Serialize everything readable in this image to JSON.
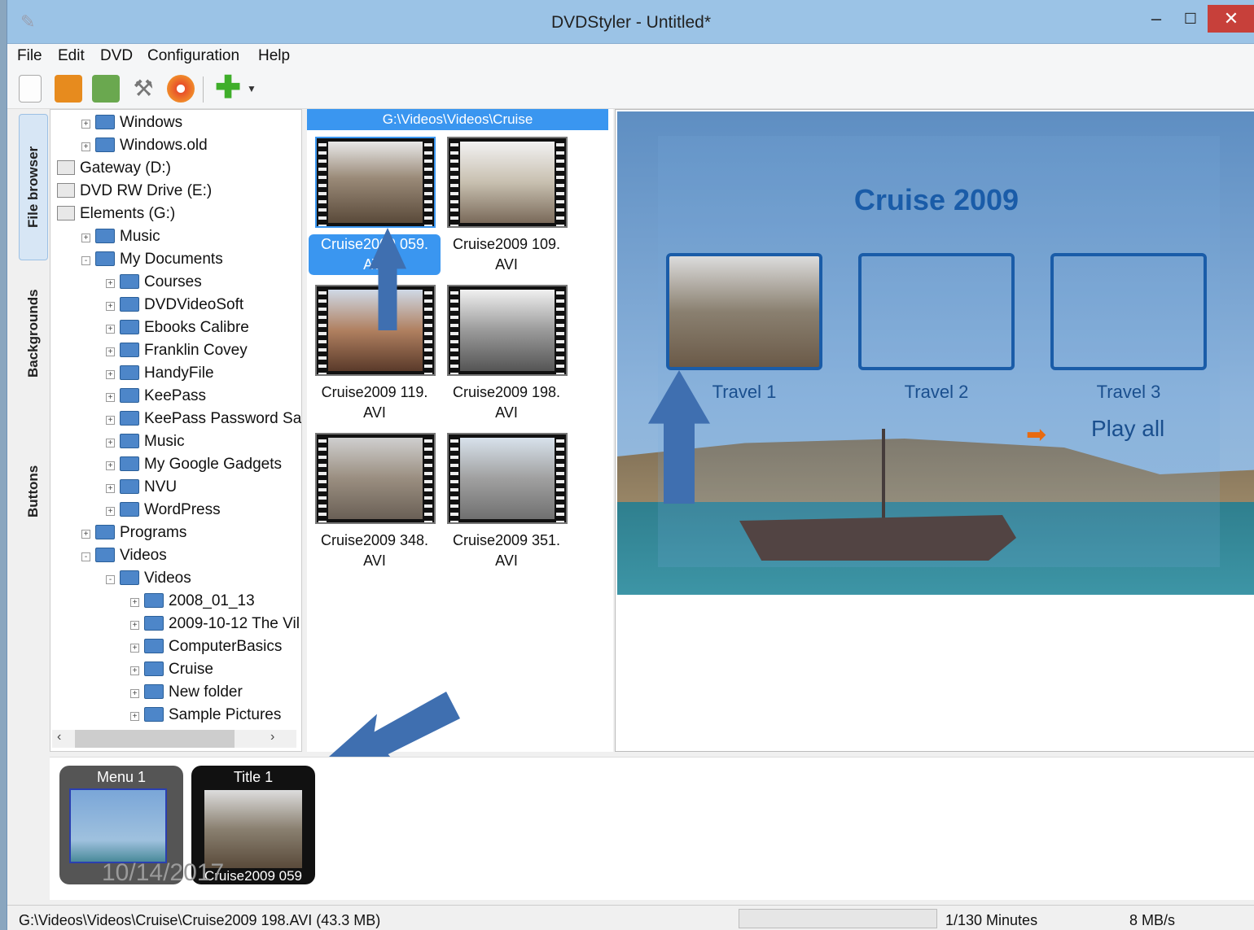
{
  "window": {
    "title": "DVDStyler - Untitled*"
  },
  "menubar": [
    "File",
    "Edit",
    "DVD",
    "Configuration",
    "Help"
  ],
  "side_tabs": [
    "File browser",
    "Backgrounds",
    "Buttons"
  ],
  "file_tree": [
    {
      "label": "Windows",
      "kind": "folder",
      "level": 1,
      "expand": "+"
    },
    {
      "label": "Windows.old",
      "kind": "folder",
      "level": 1,
      "expand": "+"
    },
    {
      "label": "Gateway (D:)",
      "kind": "drive",
      "level": 0,
      "expand": ""
    },
    {
      "label": "DVD RW Drive (E:)",
      "kind": "drive",
      "level": 0,
      "expand": ""
    },
    {
      "label": "Elements (G:)",
      "kind": "drive",
      "level": 0,
      "expand": ""
    },
    {
      "label": "Music",
      "kind": "folder",
      "level": 1,
      "expand": "+"
    },
    {
      "label": "My Documents",
      "kind": "folder",
      "level": 1,
      "expand": "-"
    },
    {
      "label": "Courses",
      "kind": "folder",
      "level": 2,
      "expand": "+"
    },
    {
      "label": "DVDVideoSoft",
      "kind": "folder",
      "level": 2,
      "expand": "+"
    },
    {
      "label": "Ebooks Calibre",
      "kind": "folder",
      "level": 2,
      "expand": "+"
    },
    {
      "label": "Franklin Covey",
      "kind": "folder",
      "level": 2,
      "expand": "+"
    },
    {
      "label": "HandyFile",
      "kind": "folder",
      "level": 2,
      "expand": "+"
    },
    {
      "label": "KeePass",
      "kind": "folder",
      "level": 2,
      "expand": "+"
    },
    {
      "label": "KeePass Password Safe",
      "kind": "folder",
      "level": 2,
      "expand": "+"
    },
    {
      "label": "Music",
      "kind": "folder",
      "level": 2,
      "expand": "+"
    },
    {
      "label": "My Google Gadgets",
      "kind": "folder",
      "level": 2,
      "expand": "+"
    },
    {
      "label": "NVU",
      "kind": "folder",
      "level": 2,
      "expand": "+"
    },
    {
      "label": "WordPress",
      "kind": "folder",
      "level": 2,
      "expand": "+"
    },
    {
      "label": "Programs",
      "kind": "folder",
      "level": 1,
      "expand": "+"
    },
    {
      "label": "Videos",
      "kind": "folder",
      "level": 1,
      "expand": "-"
    },
    {
      "label": "Videos",
      "kind": "folder",
      "level": 2,
      "expand": "-"
    },
    {
      "label": "2008_01_13",
      "kind": "folder",
      "level": 3,
      "expand": "+"
    },
    {
      "label": "2009-10-12 The Vil",
      "kind": "folder",
      "level": 3,
      "expand": "+"
    },
    {
      "label": "ComputerBasics",
      "kind": "folder",
      "level": 3,
      "expand": "+"
    },
    {
      "label": "Cruise",
      "kind": "folder",
      "level": 3,
      "expand": "+"
    },
    {
      "label": "New folder",
      "kind": "folder",
      "level": 3,
      "expand": "+"
    },
    {
      "label": "Sample Pictures",
      "kind": "folder",
      "level": 3,
      "expand": "+"
    }
  ],
  "thumbnails": {
    "path": "G:\\Videos\\Videos\\Cruise",
    "items": [
      {
        "line1": "Cruise2009 059.",
        "line2": "AVI",
        "selected": true
      },
      {
        "line1": "Cruise2009 109.",
        "line2": "AVI",
        "selected": false
      },
      {
        "line1": "Cruise2009 119.",
        "line2": "AVI",
        "selected": false
      },
      {
        "line1": "Cruise2009 198.",
        "line2": "AVI",
        "selected": false
      },
      {
        "line1": "Cruise2009 348.",
        "line2": "AVI",
        "selected": false
      },
      {
        "line1": "Cruise2009 351.",
        "line2": "AVI",
        "selected": false
      }
    ]
  },
  "menu_preview": {
    "heading": "Cruise 2009",
    "buttons": [
      "Travel 1",
      "Travel 2",
      "Travel 3"
    ],
    "play_all": "Play all"
  },
  "titleset": [
    {
      "label": "Menu 1",
      "caption": ""
    },
    {
      "label": "Title 1",
      "caption": "Cruise2009 059"
    }
  ],
  "watermark_date": "10/14/2017",
  "statusbar": {
    "file": "G:\\Videos\\Videos\\Cruise\\Cruise2009 198.AVI (43.3 MB)",
    "minutes": "1/130 Minutes",
    "rate": "8 MB/s"
  },
  "colors": {
    "accent": "#3a96f0",
    "menu_blue": "#1a5ca8",
    "arrow": "#3f6fb0",
    "close": "#c7403a"
  }
}
